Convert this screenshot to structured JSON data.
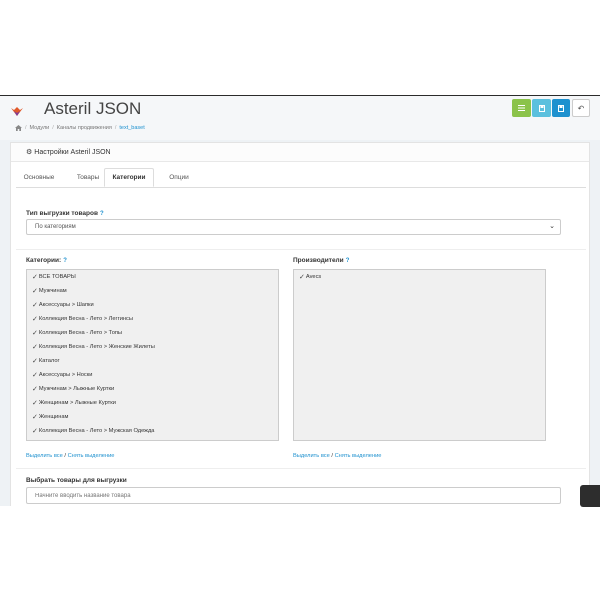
{
  "app": {
    "title": "Asteril JSON"
  },
  "toolbar": {
    "list_icon": "list-icon",
    "copy_icon": "copy-icon",
    "save_icon": "save-icon",
    "back_icon": "back-icon",
    "back_glyph": "↶"
  },
  "breadcrumb": {
    "home_icon": "home-icon",
    "sep": "/",
    "items": [
      "Модули",
      "Каналы продвижения",
      "text_baset"
    ]
  },
  "panel": {
    "title": "Настройки Asteril JSON"
  },
  "tabs": [
    "Основные",
    "Товары",
    "Категории",
    "Опции"
  ],
  "active_tab": "Категории",
  "export_type": {
    "label": "Тип выгрузки товаров",
    "value": "По категориям"
  },
  "categories": {
    "label": "Категории:",
    "items": [
      "ВСЕ ТОВАРЫ",
      "Мужчинам",
      "Аксессуары  >  Шапки",
      "Коллекция Весна - Лето  >  Леггинсы",
      "Коллекция Весна - Лето  >  Топы",
      "Коллекция Весна - Лето  >  Женские Жилеты",
      "Каталог",
      "Аксессуары  >  Носки",
      "Мужчинам  >  Лыжные Куртки",
      "Женщинам  >  Лыжные Куртки",
      "Женщинам",
      "Коллекция Весна - Лето  >  Мужская Одежда"
    ],
    "select_all": "Выделить все",
    "deselect": "Снять выделение"
  },
  "manufacturers": {
    "label": "Производители",
    "items": [
      "Avecs"
    ],
    "select_all": "Выделить все",
    "deselect": "Снять выделение"
  },
  "product_picker": {
    "label": "Выбрать товары для выгрузки",
    "placeholder": "Начните вводить название товара"
  },
  "colors": {
    "accent": "#1e91cf",
    "green": "#8bc34a",
    "light_blue": "#5bc0de"
  }
}
